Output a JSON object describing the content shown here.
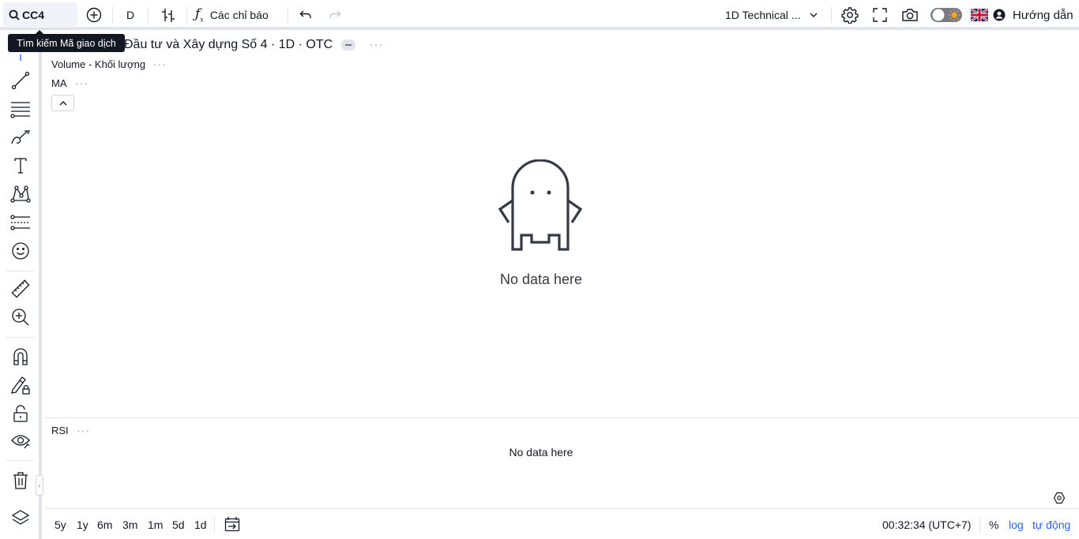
{
  "topbar": {
    "symbol": "CC4",
    "interval": "D",
    "indicators_label": "Các chỉ báo",
    "layout_name": "1D Technical ...",
    "guide_label": "Hướng dẫn"
  },
  "tooltip": {
    "text": "Tìm kiếm Mã giao dịch"
  },
  "legend": {
    "title": "Đầu tư và Xây dựng Số 4 · 1D · OTC",
    "volume": "Volume - Khối lượng",
    "ma": "MA",
    "more": "···"
  },
  "main_pane": {
    "no_data": "No data here"
  },
  "rsi_pane": {
    "label": "RSI",
    "no_data": "No data here"
  },
  "bottombar": {
    "ranges": [
      "5y",
      "1y",
      "6m",
      "3m",
      "1m",
      "5d",
      "1d"
    ],
    "clock": "00:32:34 (UTC+7)",
    "percent": "%",
    "log": "log",
    "auto": "tự động"
  },
  "colors": {
    "accent": "#2962ff",
    "text": "#131722",
    "border": "#e0e3eb",
    "sun": "#f5a623"
  },
  "icons": {
    "left": [
      "crosshair-icon",
      "trend-line-icon",
      "fib-lines-icon",
      "brush-icon",
      "text-icon",
      "pattern-icon",
      "prediction-icon",
      "emoji-icon",
      "ruler-icon",
      "zoom-in-icon",
      "magnet-icon",
      "lock-drawing-icon",
      "unlock-icon",
      "eye-icon",
      "trash-icon",
      "layers-icon"
    ]
  }
}
